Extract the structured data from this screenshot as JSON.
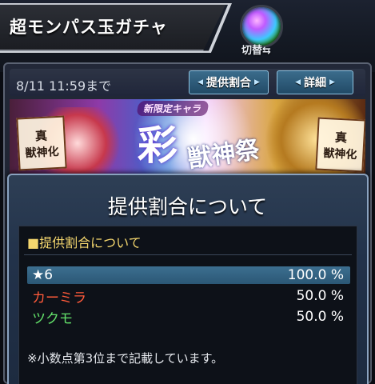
{
  "header": {
    "title": "超モンパス玉ガチャ",
    "switch_label": "切替⇆"
  },
  "info_bar": {
    "deadline": "8/11 11:59まで",
    "rate_button": "提供割合",
    "detail_button": "詳細"
  },
  "banner": {
    "tag": "新限定キャラ",
    "kanji_main": "彩",
    "kanji_sub": "獣神祭",
    "left_seal": [
      "真",
      "獣神化"
    ],
    "right_seal": [
      "真",
      "獣神化"
    ]
  },
  "modal": {
    "title": "提供割合について",
    "section_heading": "■提供割合について",
    "rows": [
      {
        "name": "★6",
        "rate": "100.0 %",
        "color": "#ffffff"
      },
      {
        "name": "カーミラ",
        "rate": "50.0 %",
        "color": "#ff5a3a"
      },
      {
        "name": "ツクモ",
        "rate": "50.0 %",
        "color": "#63e06a"
      }
    ],
    "note": "※小数点第3位まで記載しています。"
  },
  "colors": {
    "accent_blue": "#3b6c8c",
    "heading_yellow": "#f5d76e",
    "highlight_row": "#3c6f90"
  },
  "icons": [
    "orb-icon",
    "switch-arrows-icon",
    "arrow-left-icon",
    "arrow-right-icon"
  ]
}
